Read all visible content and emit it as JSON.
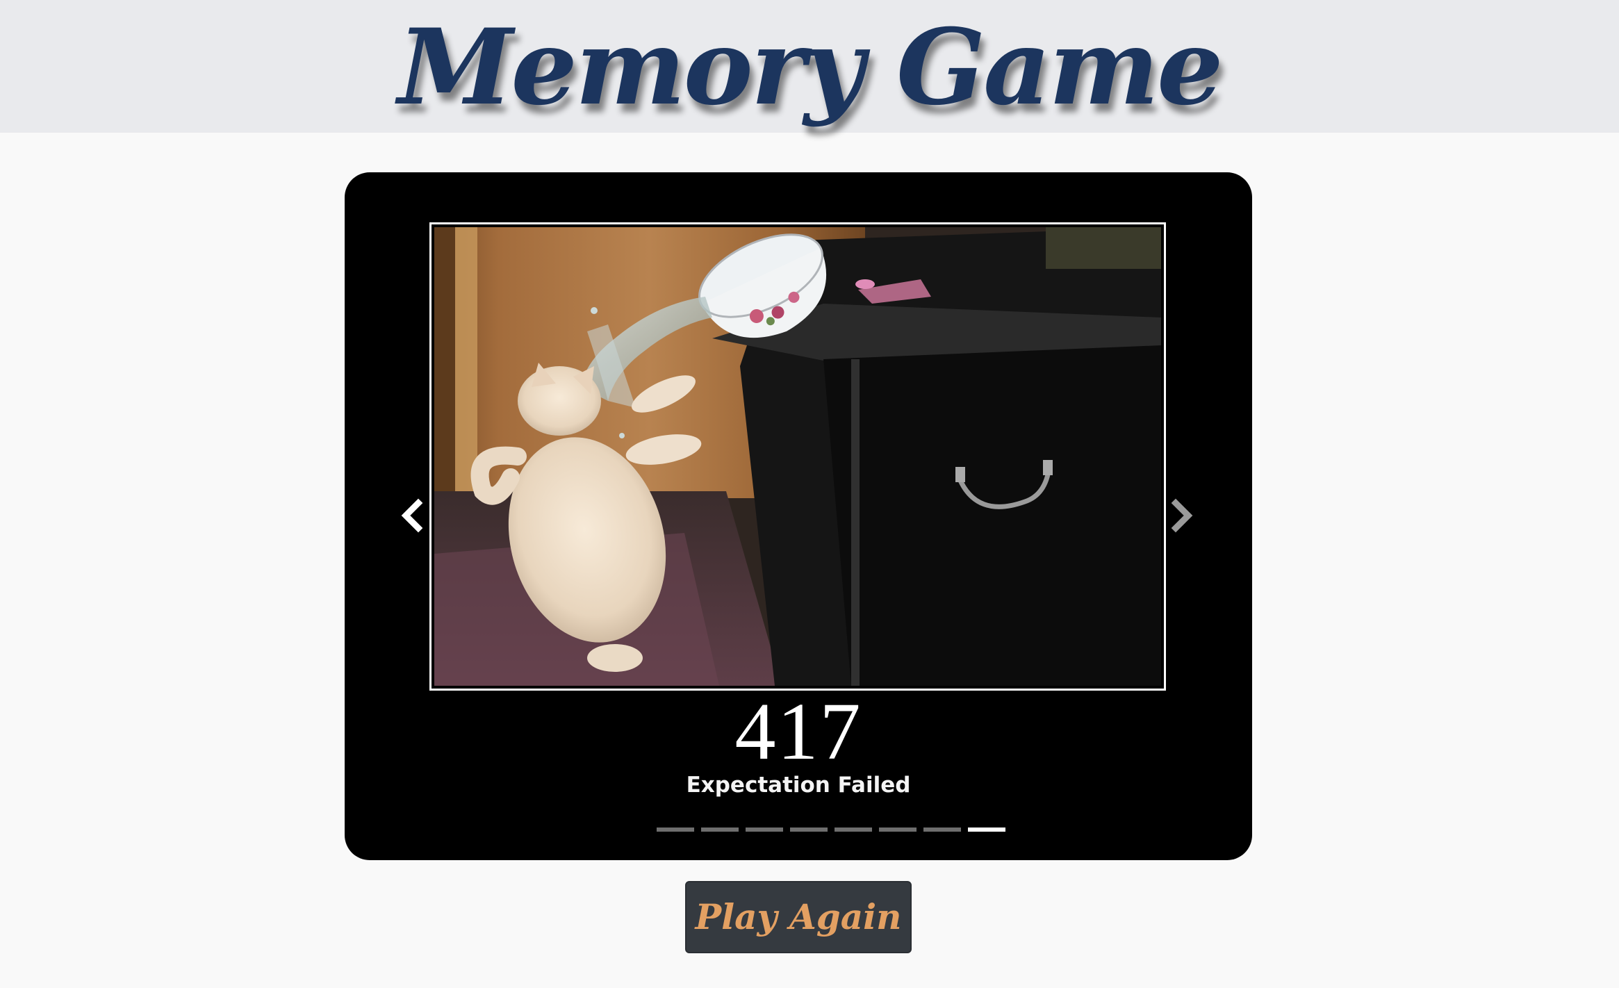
{
  "page": {
    "title": "Memory Game",
    "play_again_label": "Play Again",
    "colors": {
      "header_bg": "#e9eaed",
      "title": "#1c355e",
      "carousel_bg": "#000000",
      "button_bg": "#353a40",
      "button_text": "#e3a062",
      "indicator_active": "#ffffff",
      "indicator_inactive": "#6e6e6e"
    }
  },
  "carousel": {
    "slide_count": 8,
    "active_index": 7,
    "caption": {
      "code": "417",
      "text": "Expectation Failed"
    },
    "image_description_icon": "cat-water-photo",
    "prev_icon": "chevron-left-icon",
    "next_icon": "chevron-right-icon"
  }
}
